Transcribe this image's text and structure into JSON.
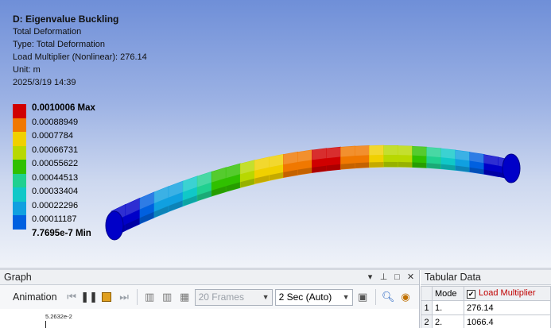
{
  "info": {
    "title": "D: Eigenvalue Buckling",
    "line1": "Total Deformation",
    "line2": "Type: Total Deformation",
    "line3": "Load Multiplier (Nonlinear): 276.14",
    "line4": "Unit: m",
    "line5": "2025/3/19 14:39"
  },
  "legend": {
    "entries": [
      {
        "label": "0.0010006 Max",
        "color": "#d00000",
        "bold": true
      },
      {
        "label": "0.00088949",
        "color": "#f07800"
      },
      {
        "label": "0.0007784",
        "color": "#f0d000"
      },
      {
        "label": "0.00066731",
        "color": "#b8d800"
      },
      {
        "label": "0.00055622",
        "color": "#30c000"
      },
      {
        "label": "0.00044513",
        "color": "#20d090"
      },
      {
        "label": "0.00033404",
        "color": "#10c8c8"
      },
      {
        "label": "0.00022296",
        "color": "#10a0e0"
      },
      {
        "label": "0.00011187",
        "color": "#0060e0"
      },
      {
        "label": "7.7695e-7 Min",
        "color": "#0000c8",
        "bold": true
      }
    ]
  },
  "graph_panel": {
    "title": "Graph",
    "animation_label": "Animation",
    "frames": "20 Frames",
    "duration": "2 Sec (Auto)",
    "y_tick": "5.2632e-2"
  },
  "tabular": {
    "title": "Tabular Data",
    "col_mode": "Mode",
    "col_lm": "Load Multiplier",
    "rows": [
      {
        "idx": "1",
        "mode": "1.",
        "value": "276.14"
      },
      {
        "idx": "2",
        "mode": "2.",
        "value": "1066.4"
      }
    ]
  }
}
